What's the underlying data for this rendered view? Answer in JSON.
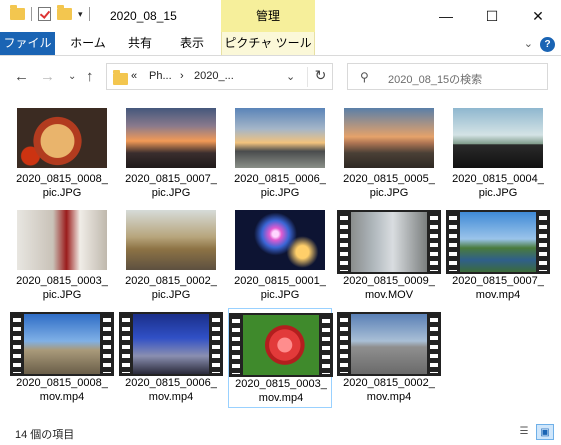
{
  "window": {
    "title": "2020_08_15",
    "contextual_tab_group": "管理"
  },
  "ribbon": {
    "tabs": [
      "ファイル",
      "ホーム",
      "共有",
      "表示",
      "ピクチャ ツール"
    ]
  },
  "nav": {
    "breadcrumb": [
      "«",
      "Ph...",
      "›",
      "2020_..."
    ],
    "search_placeholder": "2020_08_15の検索"
  },
  "files": [
    {
      "line1": "2020_0815_0008_",
      "line2": "pic.JPG",
      "kind": "image",
      "thumb": "pizza-icon"
    },
    {
      "line1": "2020_0815_0007_",
      "line2": "pic.JPG",
      "kind": "image",
      "thumb": "sunset-icon"
    },
    {
      "line1": "2020_0815_0006_",
      "line2": "pic.JPG",
      "kind": "image",
      "thumb": "sunset-road-icon"
    },
    {
      "line1": "2020_0815_0005_",
      "line2": "pic.JPG",
      "kind": "image",
      "thumb": "sunset-sea-icon"
    },
    {
      "line1": "2020_0815_0004_",
      "line2": "pic.JPG",
      "kind": "image",
      "thumb": "car-dashboard-icon"
    },
    {
      "line1": "2020_0815_0003_",
      "line2": "pic.JPG",
      "kind": "image",
      "thumb": "wine-glasses-icon"
    },
    {
      "line1": "2020_0815_0002_",
      "line2": "pic.JPG",
      "kind": "image",
      "thumb": "railway-icon"
    },
    {
      "line1": "2020_0815_0001_",
      "line2": "pic.JPG",
      "kind": "image",
      "thumb": "fireworks-icon"
    },
    {
      "line1": "2020_0815_0009_",
      "line2": "mov.MOV",
      "kind": "video",
      "thumb": "street-video-icon"
    },
    {
      "line1": "2020_0815_0007_",
      "line2": "mov.mp4",
      "kind": "video",
      "thumb": "river-video-icon"
    },
    {
      "line1": "2020_0815_0008_",
      "line2": "mov.mp4",
      "kind": "video",
      "thumb": "palace-video-icon"
    },
    {
      "line1": "2020_0815_0006_",
      "line2": "mov.mp4",
      "kind": "video",
      "thumb": "night-square-video-icon"
    },
    {
      "line1": "2020_0815_0003_",
      "line2": "mov.mp4",
      "kind": "video",
      "thumb": "rose-video-icon",
      "selected": true
    },
    {
      "line1": "2020_0815_0002_",
      "line2": "mov.mp4",
      "kind": "video",
      "thumb": "road-video-icon"
    }
  ],
  "status": {
    "item_count": "14 個の項目"
  }
}
